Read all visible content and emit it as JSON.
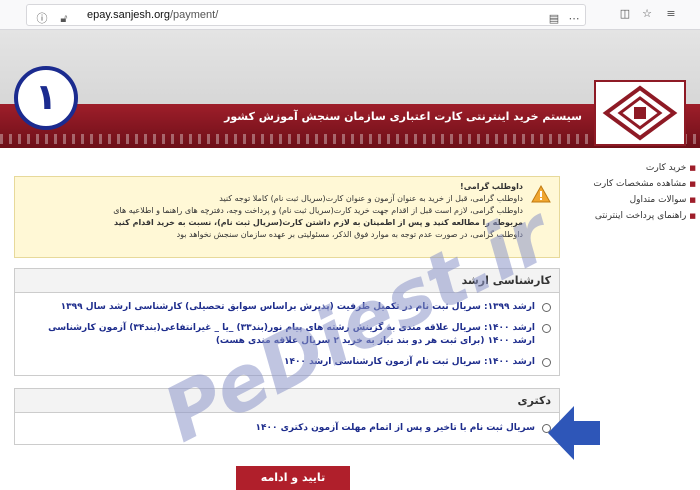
{
  "browser": {
    "url_host": "epay.sanjesh.org",
    "url_path": "/payment/"
  },
  "header": {
    "title": "سیستم خرید اینترنتی کارت اعتباری سازمان سنجش آموزش کشور",
    "step_number": "۱"
  },
  "sidebar": {
    "items": [
      "خرید کارت",
      "مشاهده مشخصات کارت",
      "سوالات متداول",
      "راهنمای پرداخت اینترنتی"
    ]
  },
  "warning": {
    "lines": [
      "داوطلب گرامی!",
      "داوطلب گرامی، قبل از خرید به عنوان آزمون و عنوان کارت(سریال ثبت نام) کاملا توجه کنید",
      "داوطلب گرامی، لازم است قبل از اقدام جهت خرید کارت(سریال ثبت نام) و پرداخت وجه، دفترچه های راهنما و اطلاعیه های",
      "مربوطه را مطالعه کنید و پس از اطمینان به لازم داشتن کارت(سریال ثبت نام)، نسبت به خرید اقدام کنید",
      "داوطلب گرامی، در صورت عدم توجه به موارد فوق الذکر، مسئولیتی بر عهده سازمان سنجش نخواهد بود"
    ]
  },
  "sections": [
    {
      "title": "کارشناسی ارشد",
      "options": [
        "ارشد ۱۳۹۹: سریال ثبت نام در تکمیل ظرفیت (پذیرش براساس سوابق تحصیلی) کارشناسی ارشد سال ۱۳۹۹",
        "ارشد ۱۴۰۰: سریال علاقه مندی به گزینش رشته های پیام نور(بند۳۳) _یا _ غیرانتفاعی(بند۳۴) آزمون کارشناسی ارشد ۱۴۰۰ (برای ثبت هر دو بند نیاز به خرید ۲ سریال علاقه مندی هست)",
        "ارشد ۱۴۰۰: سریال ثبت نام آزمون کارشناسی ارشد ۱۴۰۰"
      ]
    },
    {
      "title": "دکتری",
      "options": [
        "سریال ثبت نام با تاخیر و پس از اتمام مهلت آزمون دکتری ۱۴۰۰"
      ]
    }
  ],
  "confirm_button": "تایید و ادامه",
  "watermark": "PeDiest.ir",
  "colors": {
    "brand_red": "#9e1e2a",
    "link_blue": "#1d2c8c",
    "arrow_blue": "#2e56b8"
  }
}
